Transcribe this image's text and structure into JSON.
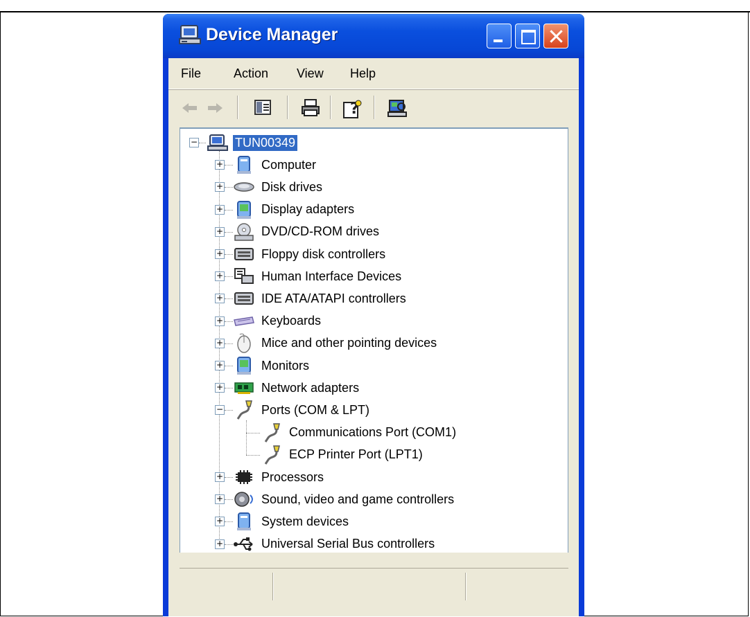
{
  "window": {
    "title": "Device Manager"
  },
  "menu": [
    "File",
    "Action",
    "View",
    "Help"
  ],
  "toolbar_buttons": [
    {
      "name": "back-icon",
      "glyph": "⇦"
    },
    {
      "name": "forward-icon",
      "glyph": "⇨"
    },
    {
      "name": "show-hide-console-tree-icon",
      "glyph": ""
    },
    {
      "name": "print-icon",
      "glyph": ""
    },
    {
      "name": "help-icon",
      "glyph": ""
    },
    {
      "name": "scan-hardware-icon",
      "glyph": ""
    }
  ],
  "tree": {
    "root": "TUN00349",
    "categories": [
      {
        "label": "Computer",
        "icon": "computer-icon",
        "expanded": false
      },
      {
        "label": "Disk drives",
        "icon": "disk-drive-icon",
        "expanded": false
      },
      {
        "label": "Display adapters",
        "icon": "display-adapter-icon",
        "expanded": false
      },
      {
        "label": "DVD/CD-ROM drives",
        "icon": "dvd-drive-icon",
        "expanded": false
      },
      {
        "label": "Floppy disk controllers",
        "icon": "floppy-controller-icon",
        "expanded": false
      },
      {
        "label": "Human Interface Devices",
        "icon": "hid-icon",
        "expanded": false
      },
      {
        "label": "IDE ATA/ATAPI controllers",
        "icon": "ide-controller-icon",
        "expanded": false
      },
      {
        "label": "Keyboards",
        "icon": "keyboard-icon",
        "expanded": false
      },
      {
        "label": "Mice and other pointing devices",
        "icon": "mouse-icon",
        "expanded": false
      },
      {
        "label": "Monitors",
        "icon": "monitor-icon",
        "expanded": false
      },
      {
        "label": "Network adapters",
        "icon": "network-adapter-icon",
        "expanded": false
      },
      {
        "label": "Ports (COM & LPT)",
        "icon": "port-icon",
        "expanded": true,
        "children": [
          "Communications Port (COM1)",
          "ECP Printer Port (LPT1)"
        ]
      },
      {
        "label": "Processors",
        "icon": "processor-icon",
        "expanded": false
      },
      {
        "label": "Sound, video and game controllers",
        "icon": "sound-icon",
        "expanded": false
      },
      {
        "label": "System devices",
        "icon": "system-device-icon",
        "expanded": false
      },
      {
        "label": "Universal Serial Bus controllers",
        "icon": "usb-icon",
        "expanded": false
      }
    ]
  },
  "colors": {
    "title_bar": "#0a4fde",
    "selection": "#316ac5",
    "face": "#ece9d8"
  }
}
